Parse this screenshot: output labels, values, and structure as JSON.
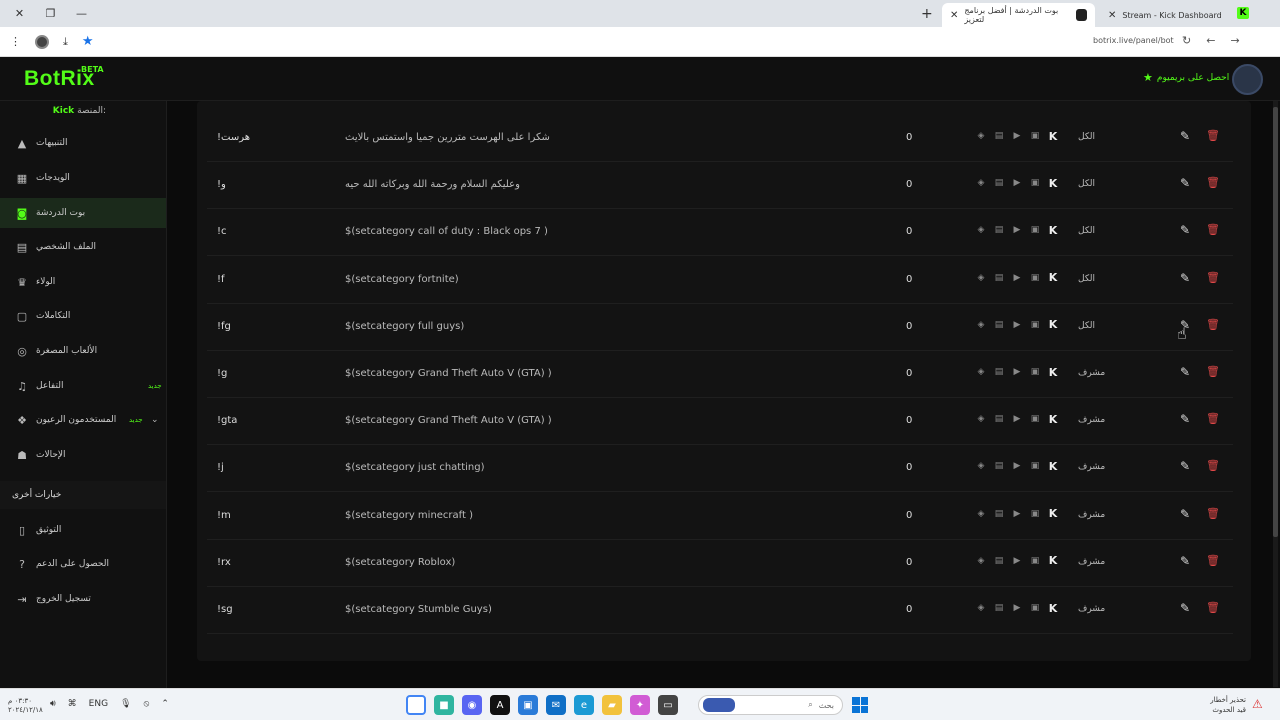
{
  "browser": {
    "tabs": [
      {
        "title": "Stream - Kick Dashboard",
        "active": false
      },
      {
        "title": "بوت الدردشة | أفضل برنامج لتعزيز",
        "active": true
      }
    ],
    "url": "botrix.live/panel/bot",
    "icons": [
      "close-icon",
      "maximize-icon",
      "minimize-icon",
      "new-tab-icon",
      "menu-icon",
      "profile-icon",
      "download-icon",
      "bookmark-star-icon",
      "back-icon",
      "forward-icon",
      "reload-icon",
      "translate-icon"
    ]
  },
  "app": {
    "logo": "BotRix",
    "beta": "BETA",
    "premium": "احصل على بريميوم",
    "platform_label": "المنصة:",
    "platform_value": "Kick"
  },
  "sidebar": {
    "items": [
      {
        "label": "التنبيهات",
        "icon": "warning-icon"
      },
      {
        "label": "الويدجات",
        "icon": "widgets-icon"
      },
      {
        "label": "بوت الدردشة",
        "icon": "robot-icon",
        "active": true
      },
      {
        "label": "الملف الشخصي",
        "icon": "id-card-icon"
      },
      {
        "label": "الولاء",
        "icon": "trophy-icon"
      },
      {
        "label": "التكاملات",
        "icon": "integration-icon"
      },
      {
        "label": "الألعاب المصغرة",
        "icon": "gamepad-icon"
      },
      {
        "label": "التفاعل",
        "icon": "music-icon",
        "badge": "جديد"
      },
      {
        "label": "المستخدمون الرعيون",
        "icon": "users-icon",
        "badge": "جديد"
      },
      {
        "label": "الإحالات",
        "icon": "referral-icon"
      }
    ],
    "section_other": "خيارات أخرى",
    "other_items": [
      {
        "label": "التوثيق",
        "icon": "document-icon"
      },
      {
        "label": "الحصول على الدعم",
        "icon": "help-icon"
      },
      {
        "label": "تسجيل الخروج",
        "icon": "logout-icon"
      }
    ]
  },
  "commands": [
    {
      "cmd": "!هرست",
      "response": "شكرا على الهرست متررين جميا واستمتس بالايث",
      "count": "0",
      "role": "الكل"
    },
    {
      "cmd": "!و",
      "response": "وعليكم السلام ورحمة الله وبركاته الله حيه",
      "count": "0",
      "role": "الكل"
    },
    {
      "cmd": "!c",
      "response": "$(setcategory call of duty : Black ops 7 )",
      "count": "0",
      "role": "الكل"
    },
    {
      "cmd": "!f",
      "response": "$(setcategory fortnite)",
      "count": "0",
      "role": "الكل"
    },
    {
      "cmd": "!fg",
      "response": "$(setcategory full guys)",
      "count": "0",
      "role": "الكل"
    },
    {
      "cmd": "!g",
      "response": "$(setcategory Grand Theft Auto V (GTA) )",
      "count": "0",
      "role": "مشرف"
    },
    {
      "cmd": "!gta",
      "response": "$(setcategory Grand Theft Auto V (GTA) )",
      "count": "0",
      "role": "مشرف"
    },
    {
      "cmd": "!j",
      "response": "$(setcategory just chatting)",
      "count": "0",
      "role": "مشرف"
    },
    {
      "cmd": "!m",
      "response": "$(setcategory minecraft )",
      "count": "0",
      "role": "مشرف"
    },
    {
      "cmd": "!rx",
      "response": "$(setcategory Roblox)",
      "count": "0",
      "role": "مشرف"
    },
    {
      "cmd": "!sg",
      "response": "$(setcategory Stumble Guys)",
      "count": "0",
      "role": "مشرف"
    }
  ],
  "taskbar": {
    "time": "٠٣:٣٠ م",
    "date": "٢٠٢٤/١٢/١٨",
    "lang": "ENG",
    "search_placeholder": "بحث",
    "news_line1": "تحذير أخطار",
    "news_line2": "قيد الحدوث"
  }
}
